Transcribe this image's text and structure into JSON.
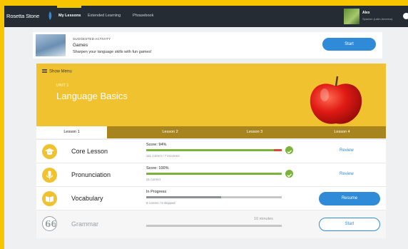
{
  "nav": {
    "brand": "Rosetta Stone",
    "links": [
      "My Lessons",
      "Extended Learning",
      "Phrasebook"
    ],
    "user": {
      "name": "Alex",
      "course": "Spanish (Latin America)"
    }
  },
  "suggested": {
    "kicker": "SUGGESTED ACTIVITY",
    "title": "Games",
    "subtitle": "Sharpen your language skills with fun games!",
    "button": "Start"
  },
  "unit": {
    "show_menu": "Show Menu",
    "label": "UNIT 1",
    "title": "Language Basics"
  },
  "tabs": [
    "Lesson 1",
    "Lesson 2",
    "Lesson 3",
    "Lesson 4"
  ],
  "lessons": [
    {
      "name": "Core Lesson",
      "status": "Score: 94%",
      "progress": 0.94,
      "sub": "111 correct / 7 incorrect",
      "action": "Review",
      "icon": "graduation-cap-icon"
    },
    {
      "name": "Pronunciation",
      "status": "Score: 100%",
      "progress": 1.0,
      "sub": "21 correct",
      "action": "Review",
      "icon": "microphone-icon"
    },
    {
      "name": "Vocabulary",
      "status": "In Progress",
      "progress": 0.55,
      "sub": "8 correct / 8 skipped",
      "action": "Resume",
      "icon": "book-icon"
    },
    {
      "name": "Grammar",
      "status": "",
      "minutes": "10 minutes",
      "action": "Start",
      "icon": "quote-icon"
    }
  ],
  "colors": {
    "accent": "#2f8bd8",
    "unit_yellow": "#f0c230",
    "success": "#7bb33b",
    "error": "#d84a38"
  }
}
